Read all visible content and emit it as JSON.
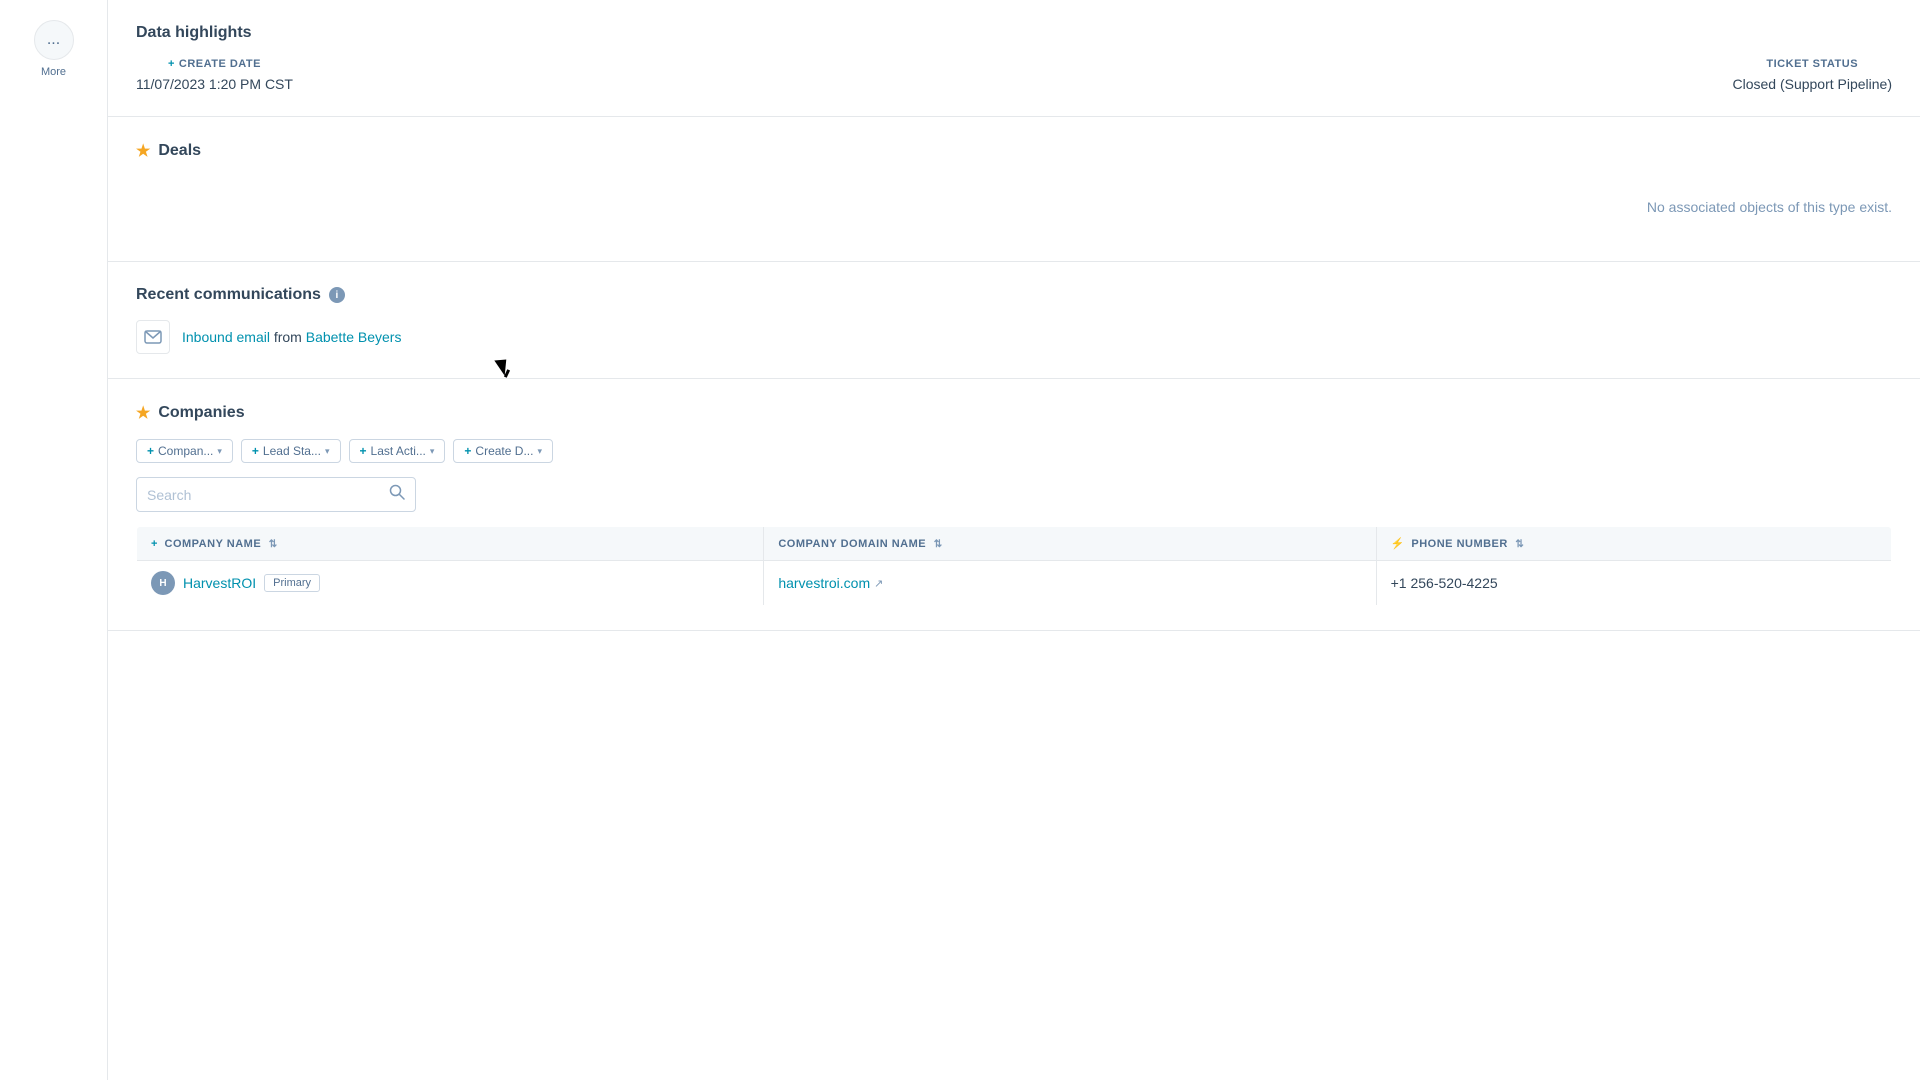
{
  "sidebar": {
    "more_button_dots": "...",
    "more_label": "More"
  },
  "data_highlights": {
    "section_title": "Data highlights",
    "create_date": {
      "label": "CREATE DATE",
      "value": "11/07/2023 1:20 PM CST",
      "prefix": "+ "
    },
    "ticket_status": {
      "label": "TICKET STATUS",
      "value": "Closed (Support Pipeline)"
    }
  },
  "deals": {
    "section_title": "Deals",
    "no_objects_text": "No associated objects of this type exist."
  },
  "recent_communications": {
    "section_title": "Recent communications",
    "info_icon_label": "i",
    "comm_item": {
      "email_link_text": "Inbound email",
      "from_text": " from ",
      "sender_link_text": "Babette Beyers"
    }
  },
  "companies": {
    "section_title": "Companies",
    "filters": [
      {
        "label": "Compan...",
        "prefix": "+ "
      },
      {
        "label": "Lead Sta...",
        "prefix": "+ "
      },
      {
        "label": "Last Acti...",
        "prefix": "+ "
      },
      {
        "label": "Create D...",
        "prefix": "+ "
      }
    ],
    "search_placeholder": "Search",
    "table_headers": [
      {
        "label": "COMPANY NAME",
        "prefix": "+ ",
        "sortable": true
      },
      {
        "label": "COMPANY DOMAIN NAME",
        "sortable": true
      },
      {
        "label": "PHONE NUMBER",
        "sortable": true,
        "lightning": true
      }
    ],
    "table_rows": [
      {
        "company_name": "HarvestROI",
        "is_primary": true,
        "primary_badge": "Primary",
        "domain": "harvestroi.com",
        "phone": "+1 256-520-4225",
        "avatar_initials": "H"
      }
    ]
  }
}
